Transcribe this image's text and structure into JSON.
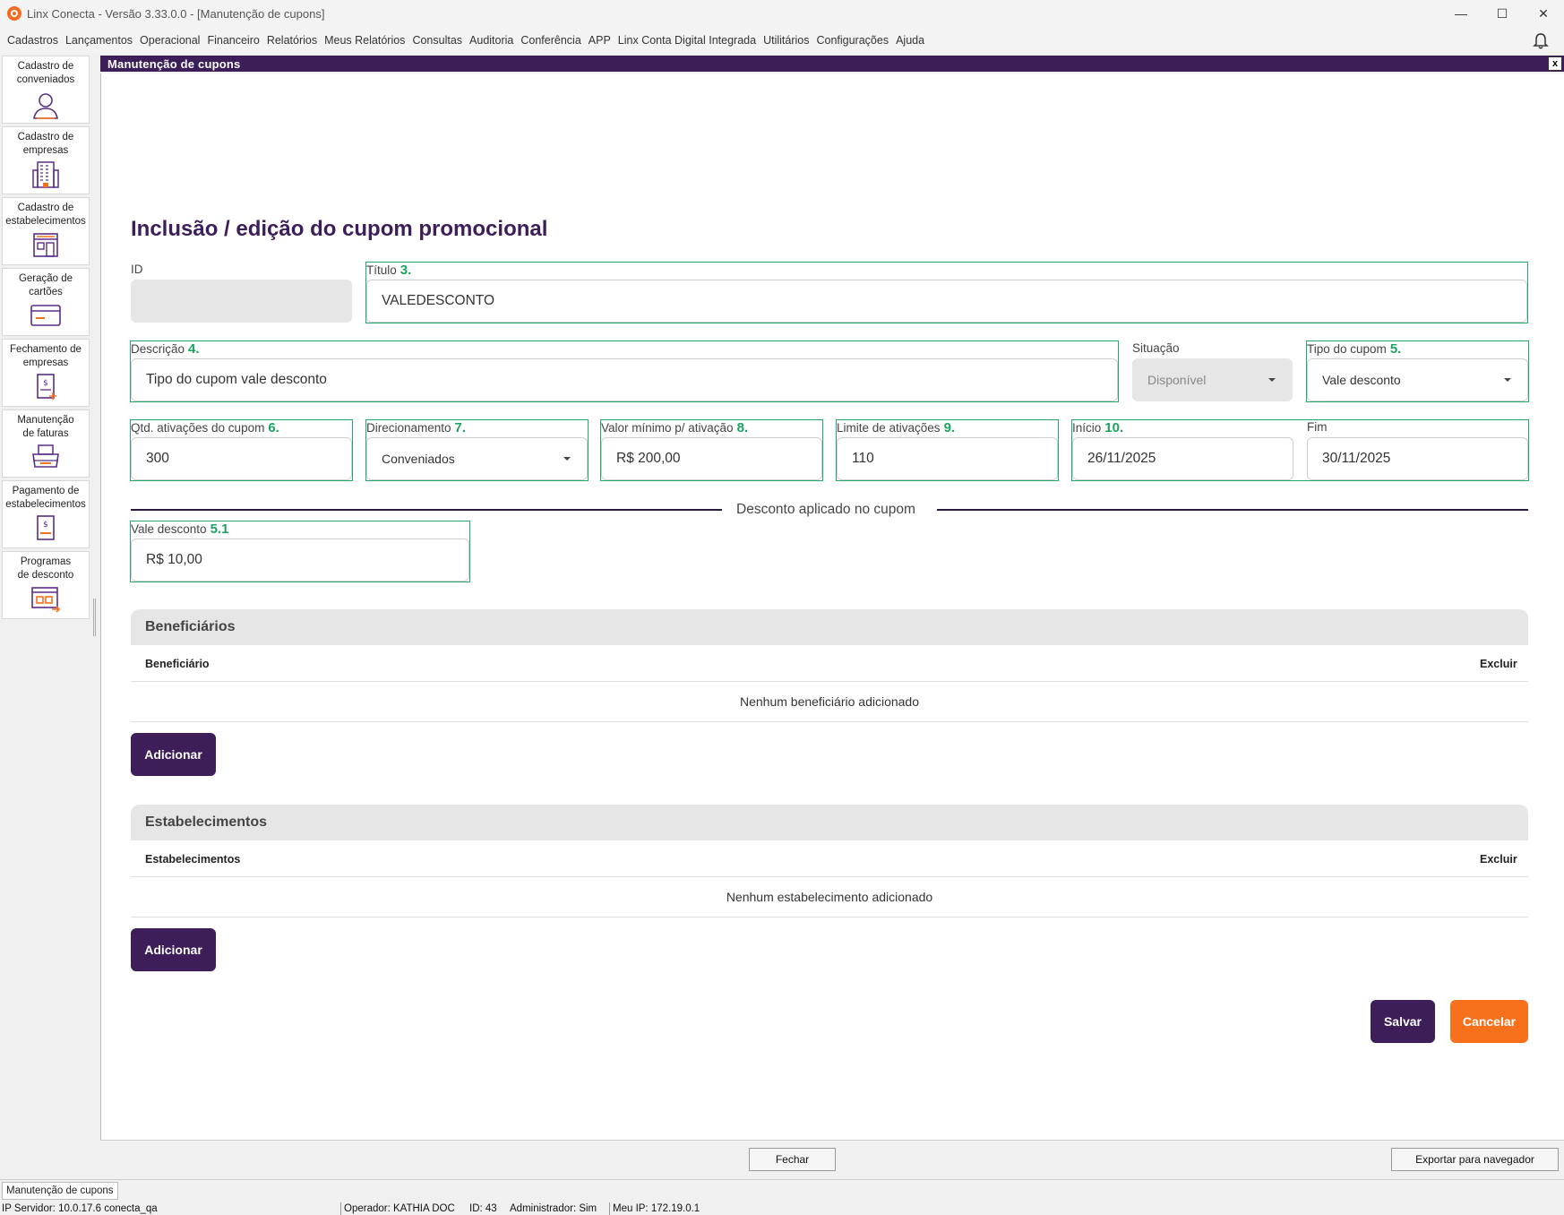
{
  "window": {
    "title": "Linx Conecta - Versão 3.33.0.0 - [Manutenção de cupons]",
    "minimize": "—",
    "maximize": "☐",
    "close": "✕"
  },
  "menu": [
    "Cadastros",
    "Lançamentos",
    "Operacional",
    "Financeiro",
    "Relatórios",
    "Meus Relatórios",
    "Consultas",
    "Auditoria",
    "Conferência",
    "APP",
    "Linx Conta Digital Integrada",
    "Utilitários",
    "Configurações",
    "Ajuda"
  ],
  "sidebar": [
    {
      "label": "Cadastro de conveniados",
      "icon": "user-icon"
    },
    {
      "label": "Cadastro de empresas",
      "icon": "building-icon"
    },
    {
      "label": "Cadastro de estabelecimentos",
      "icon": "store-icon"
    },
    {
      "label": "Geração de cartões",
      "icon": "card-icon"
    },
    {
      "label": "Fechamento de empresas",
      "icon": "invoice-close-icon"
    },
    {
      "label": "Manutenção de faturas",
      "icon": "printer-icon"
    },
    {
      "label": "Pagamento de estabelecimentos",
      "icon": "payment-icon"
    },
    {
      "label": "Programas de desconto",
      "icon": "discount-program-icon"
    }
  ],
  "mdi": {
    "title": "Manutenção de cupons",
    "close": "x"
  },
  "form": {
    "heading": "Inclusão / edição do cupom promocional",
    "id": {
      "label": "ID",
      "value": ""
    },
    "titulo": {
      "label": "Título",
      "num": "3.",
      "value": "VALEDESCONTO"
    },
    "descricao": {
      "label": "Descrição",
      "num": "4.",
      "value": "Tipo do cupom vale desconto"
    },
    "situacao": {
      "label": "Situação",
      "value": "Disponível"
    },
    "tipo": {
      "label": "Tipo do cupom",
      "num": "5.",
      "value": "Vale desconto"
    },
    "qtd": {
      "label": "Qtd. ativações do cupom",
      "num": "6.",
      "value": "300"
    },
    "direcionamento": {
      "label": "Direcionamento",
      "num": "7.",
      "value": "Conveniados"
    },
    "valor_minimo": {
      "label": "Valor mínimo p/ ativação",
      "num": "8.",
      "value": "R$ 200,00"
    },
    "limite": {
      "label": "Limite de ativações",
      "num": "9.",
      "value": "110"
    },
    "inicio": {
      "label": "Início",
      "num": "10.",
      "value": "26/11/2025"
    },
    "fim": {
      "label": "Fim",
      "value": "30/11/2025"
    },
    "divider_text": "Desconto aplicado no cupom",
    "vale": {
      "label": "Vale desconto",
      "num": "5.1",
      "value": "R$ 10,00"
    }
  },
  "beneficiarios": {
    "title": "Beneficiários",
    "col1": "Beneficiário",
    "col2": "Excluir",
    "empty": "Nenhum beneficiário adicionado",
    "add": "Adicionar"
  },
  "estabelecimentos": {
    "title": "Estabelecimentos",
    "col1": "Estabelecimentos",
    "col2": "Excluir",
    "empty": "Nenhum estabelecimento adicionado",
    "add": "Adicionar"
  },
  "actions": {
    "save": "Salvar",
    "cancel": "Cancelar"
  },
  "bottom": {
    "close": "Fechar",
    "export": "Exportar para navegador"
  },
  "taskbar": {
    "tab": "Manutenção de cupons"
  },
  "status": {
    "server": "IP Servidor: 10.0.17.6 conecta_qa",
    "operator": "Operador: KATHIA DOC",
    "id": "ID: 43",
    "admin": "Administrador: Sim",
    "myip": "Meu IP: 172.19.0.1"
  }
}
